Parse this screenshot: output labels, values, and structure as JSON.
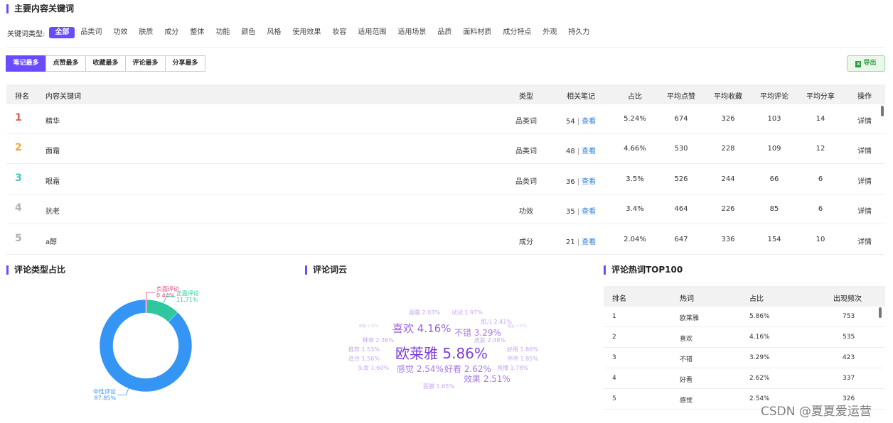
{
  "section_titles": {
    "keywords": "主要内容关键词",
    "comment_type": "评论类型占比",
    "word_cloud": "评论词云",
    "hot_words": "评论热词TOP100"
  },
  "filter": {
    "label": "关键词类型:",
    "items": [
      "全部",
      "品类词",
      "功效",
      "肤质",
      "成分",
      "整体",
      "功能",
      "颜色",
      "风格",
      "使用效果",
      "妆容",
      "适用范围",
      "适用场景",
      "品质",
      "面料材质",
      "成分特点",
      "外观",
      "持久力"
    ],
    "active_index": 0,
    "accent_color": "#6b4bff"
  },
  "tabs": [
    "笔记最多",
    "点赞最多",
    "收藏最多",
    "评论最多",
    "分享最多"
  ],
  "export_label": "导出",
  "table": {
    "headers": [
      "排名",
      "内容关键词",
      "类型",
      "相关笔记",
      "占比",
      "平均点赞",
      "平均收藏",
      "平均评论",
      "平均分享",
      "操作"
    ],
    "view_label": "查看",
    "detail_label": "详情",
    "rank_colors": [
      "#e05a5a",
      "#f0a830",
      "#44c4c4",
      "#b0b0b0",
      "#b0b0b0"
    ],
    "rows": [
      {
        "rank": "1",
        "keyword": "精华",
        "type": "品类词",
        "notes": "54",
        "ratio": "5.24%",
        "likes": "674",
        "favs": "326",
        "comments": "103",
        "shares": "14"
      },
      {
        "rank": "2",
        "keyword": "面霜",
        "type": "品类词",
        "notes": "48",
        "ratio": "4.66%",
        "likes": "530",
        "favs": "228",
        "comments": "109",
        "shares": "12"
      },
      {
        "rank": "3",
        "keyword": "眼霜",
        "type": "品类词",
        "notes": "36",
        "ratio": "3.5%",
        "likes": "526",
        "favs": "244",
        "comments": "66",
        "shares": "6"
      },
      {
        "rank": "4",
        "keyword": "抗老",
        "type": "功效",
        "notes": "35",
        "ratio": "3.4%",
        "likes": "464",
        "favs": "226",
        "comments": "85",
        "shares": "6"
      },
      {
        "rank": "5",
        "keyword": "a醇",
        "type": "成分",
        "notes": "21",
        "ratio": "2.04%",
        "likes": "647",
        "favs": "336",
        "comments": "154",
        "shares": "10"
      }
    ]
  },
  "chart_data": {
    "type": "pie",
    "title": "评论类型占比",
    "slices": [
      {
        "label": "负面评论",
        "value": 0.44,
        "value_label": "0.44%",
        "color": "#e0457a"
      },
      {
        "label": "正面评论",
        "value": 11.71,
        "value_label": "11.71%",
        "color": "#2ec7a0"
      },
      {
        "label": "中性评论",
        "value": 87.85,
        "value_label": "87.85%",
        "color": "#3595f5"
      }
    ],
    "donut": true
  },
  "word_cloud": [
    {
      "text": "欧莱雅 5.86%",
      "tier": "xl"
    },
    {
      "text": "喜欢 4.16%",
      "tier": "l"
    },
    {
      "text": "不错 3.29%",
      "tier": "m"
    },
    {
      "text": "好看 2.62%",
      "tier": "m"
    },
    {
      "text": "感觉 2.54%",
      "tier": "m"
    },
    {
      "text": "效果 2.51%",
      "tier": "m"
    },
    {
      "text": "皮肤 2.48%",
      "tier": "s"
    },
    {
      "text": "甜儿 2.41%",
      "tier": "s"
    },
    {
      "text": "种草 2.36%",
      "tier": "s"
    },
    {
      "text": "面霜 2.03%",
      "tier": "s"
    },
    {
      "text": "试试 1.97%",
      "tier": "s"
    },
    {
      "text": "好用 1.86%",
      "tier": "s"
    },
    {
      "text": "冲冲 1.85%",
      "tier": "s"
    },
    {
      "text": "直播 1.78%",
      "tier": "s"
    },
    {
      "text": "面膜 1.65%",
      "tier": "s"
    },
    {
      "text": "头发 1.60%",
      "tier": "s"
    },
    {
      "text": "适合 1.56%",
      "tier": "s"
    },
    {
      "text": "推荐 1.53%",
      "tier": "s"
    },
    {
      "text": "眼霜 1.42%",
      "tier": "xs"
    },
    {
      "text": "覆盖 1.36%",
      "tier": "xs"
    }
  ],
  "hot_words": {
    "headers": [
      "排名",
      "热词",
      "占比",
      "出现频次"
    ],
    "rows": [
      {
        "rank": "1",
        "word": "欧莱雅",
        "ratio": "5.86%",
        "count": "753"
      },
      {
        "rank": "2",
        "word": "喜欢",
        "ratio": "4.16%",
        "count": "535"
      },
      {
        "rank": "3",
        "word": "不错",
        "ratio": "3.29%",
        "count": "423"
      },
      {
        "rank": "4",
        "word": "好看",
        "ratio": "2.62%",
        "count": "337"
      },
      {
        "rank": "5",
        "word": "感觉",
        "ratio": "2.54%",
        "count": "326"
      }
    ]
  },
  "watermark": "CSDN @夏夏爱运营"
}
